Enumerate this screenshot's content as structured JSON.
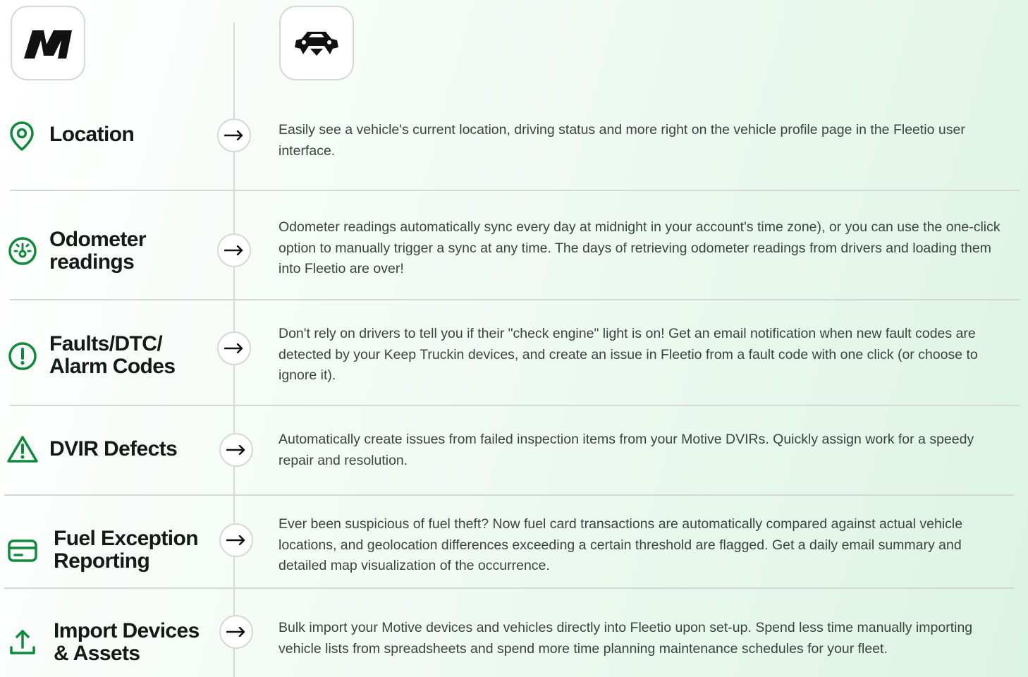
{
  "header": {
    "partner_logo": "motive-logo",
    "fleetio_logo": "car-icon"
  },
  "colors": {
    "accent_green": "#0f8a3c",
    "title_text": "#141a17",
    "body_text": "#3a433e",
    "divider": "#d5dad6"
  },
  "features": [
    {
      "icon": "location-pin-icon",
      "title": "Location",
      "description": "Easily see a vehicle's current location, driving status and more right on the vehicle profile page in the Fleetio user interface."
    },
    {
      "icon": "odometer-icon",
      "title": "Odometer\nreadings",
      "description": "Odometer readings automatically sync every day at midnight in your account's time zone), or you can use the one-click option to manually trigger a sync at any time. The days of retrieving odometer readings from drivers and loading them into Fleetio are over!"
    },
    {
      "icon": "alert-circle-icon",
      "title": "Faults/DTC/\nAlarm Codes",
      "description": "Don't rely on drivers to tell you if their \"check engine\" light is on! Get an email notification when new fault codes are detected by your Keep Truckin devices, and create an issue in Fleetio from a fault code with one click (or choose to ignore it)."
    },
    {
      "icon": "warning-triangle-icon",
      "title": "DVIR Defects",
      "description": "Automatically create issues from failed inspection items from your Motive DVIRs. Quickly assign work for a speedy repair and resolution."
    },
    {
      "icon": "credit-card-icon",
      "title": "Fuel Exception\nReporting",
      "description": "Ever been suspicious of fuel theft? Now fuel card transactions are automatically compared against actual vehicle locations, and geolocation differences exceeding a certain threshold are flagged. Get a daily email summary and detailed map visualization of the occurrence."
    },
    {
      "icon": "upload-icon",
      "title": "Import Devices\n& Assets",
      "description": "Bulk import your Motive devices and vehicles directly into Fleetio upon set-up. Spend less time manually importing vehicle lists from spreadsheets and spend more time planning maintenance schedules for your fleet."
    }
  ]
}
